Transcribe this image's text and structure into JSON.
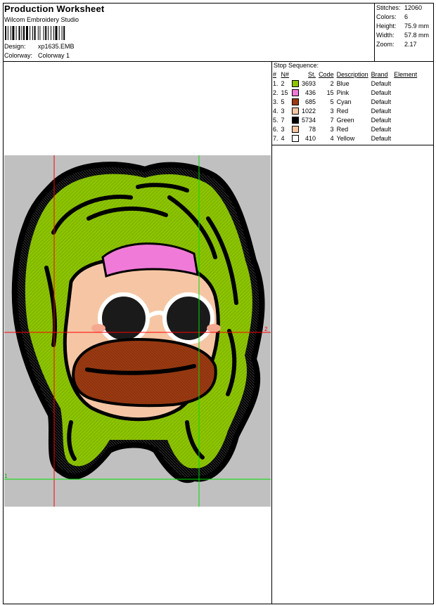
{
  "header": {
    "title": "Production Worksheet",
    "company": "Wilcom Embroidery Studio",
    "design_label": "Design:",
    "design_value": "xp1635.EMB",
    "colorway_label": "Colorway:",
    "colorway_value": "Colorway 1"
  },
  "stats": [
    {
      "label": "Stitches:",
      "value": "12060"
    },
    {
      "label": "Colors:",
      "value": "6"
    },
    {
      "label": "Height:",
      "value": "75.9 mm"
    },
    {
      "label": "Width:",
      "value": "57.8 mm"
    },
    {
      "label": "Zoom:",
      "value": "2.17"
    }
  ],
  "stop_sequence": {
    "title": "Stop Sequence:",
    "columns": [
      "#",
      "N#",
      "St.",
      "Code",
      "Description",
      "Brand",
      "Element"
    ],
    "rows": [
      {
        "idx": "1.",
        "n": "2",
        "color": "#8cc400",
        "st": "3693",
        "code": "2",
        "description": "Blue",
        "brand": "Default"
      },
      {
        "idx": "2.",
        "n": "15",
        "color": "#f07ad8",
        "st": "436",
        "code": "15",
        "description": "Pink",
        "brand": "Default"
      },
      {
        "idx": "3.",
        "n": "5",
        "color": "#9a3a12",
        "st": "685",
        "code": "5",
        "description": "Cyan",
        "brand": "Default"
      },
      {
        "idx": "4.",
        "n": "3",
        "color": "#f6c6a4",
        "st": "1022",
        "code": "3",
        "description": "Red",
        "brand": "Default"
      },
      {
        "idx": "5.",
        "n": "7",
        "color": "#000000",
        "st": "5734",
        "code": "7",
        "description": "Green",
        "brand": "Default"
      },
      {
        "idx": "6.",
        "n": "3",
        "color": "#f6c6a4",
        "st": "78",
        "code": "3",
        "description": "Red",
        "brand": "Default"
      },
      {
        "idx": "7.",
        "n": "4",
        "color": "#ffffff",
        "st": "410",
        "code": "4",
        "description": "Yellow",
        "brand": "Default"
      }
    ]
  },
  "preview": {
    "axis_labels": [
      "2",
      "1"
    ],
    "colors": {
      "background": "#c0c0c0",
      "hair": "#8cc400",
      "outline": "#000000",
      "band": "#f07ad8",
      "skin": "#f6c6a4",
      "mouth": "#9a3a12",
      "glasses": "#ffffff",
      "guide_red": "#ff0000",
      "guide_green": "#00dd00"
    }
  }
}
